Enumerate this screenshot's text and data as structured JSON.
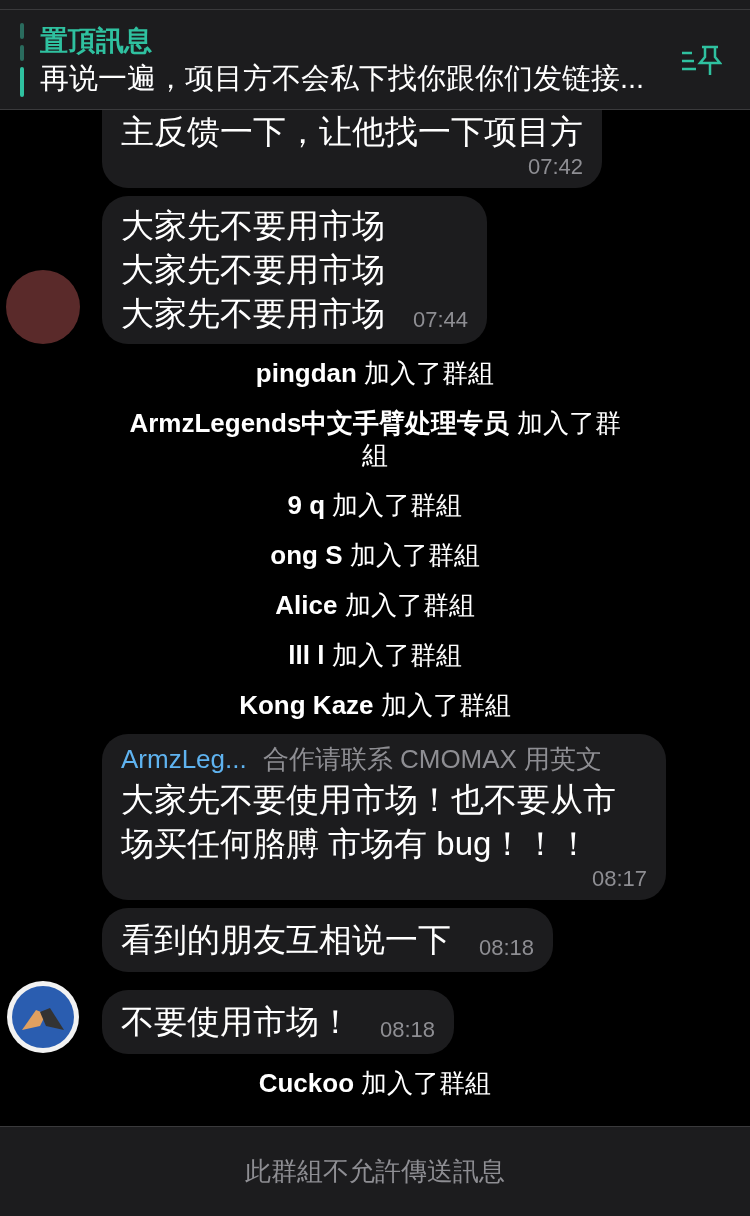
{
  "pinned": {
    "title": "置頂訊息",
    "text": "再说一遍，项目方不会私下找你跟你们发链接..."
  },
  "messages": [
    {
      "kind": "message",
      "lines": [
        "主反馈一下，让他找一下项目方"
      ],
      "time": "07:42",
      "continued": true
    },
    {
      "kind": "message",
      "lines": [
        "大家先不要用市场",
        "大家先不要用市场",
        "大家先不要用市场"
      ],
      "time": "07:44",
      "avatar": {
        "kind": "photo"
      }
    },
    {
      "kind": "service",
      "text": "**pingdan** 加入了群組"
    },
    {
      "kind": "service",
      "text": "**ArmzLegends中文手臂处理专员** 加入了群組"
    },
    {
      "kind": "service",
      "text": "**9 q** 加入了群組"
    },
    {
      "kind": "service",
      "text": "**ong S** 加入了群組"
    },
    {
      "kind": "service",
      "text": "**Alice** 加入了群組"
    },
    {
      "kind": "service",
      "text": "**lll l** 加入了群組"
    },
    {
      "kind": "service",
      "text": "**Kong Kaze** 加入了群組"
    },
    {
      "kind": "message",
      "sender": "ArmzLeg...",
      "sender_note": "合作请联系 CMOMAX 用英文",
      "lines": [
        "大家先不要使用市场！也不要从市场买任何胳膊 市场有 bug！！！"
      ],
      "time": "08:17"
    },
    {
      "kind": "message",
      "lines": [
        "看到的朋友互相说一下"
      ],
      "time": "08:18"
    },
    {
      "kind": "message",
      "lines": [
        "不要使用市场！"
      ],
      "time": "08:18",
      "avatar": {
        "kind": "logo"
      }
    },
    {
      "kind": "service",
      "text": "**Cuckoo** 加入了群組"
    }
  ],
  "footer": {
    "notice": "此群組不允許傳送訊息"
  }
}
